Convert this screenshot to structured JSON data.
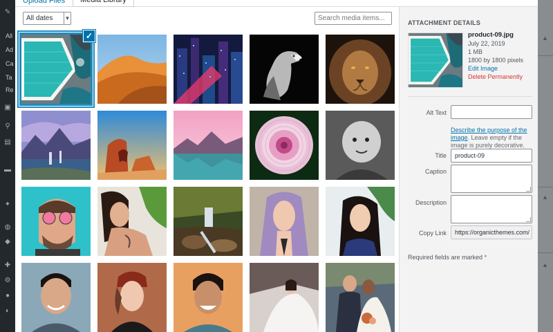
{
  "tabs": [
    {
      "label": "Upload Files",
      "active": false
    },
    {
      "label": "Media Library",
      "active": true
    }
  ],
  "filter": {
    "selected": "All dates"
  },
  "search": {
    "placeholder": "Search media items..."
  },
  "attachment": {
    "heading": "ATTACHMENT DETAILS",
    "filename": "product-09.jpg",
    "date": "July 22, 2019",
    "size": "1 MB",
    "dimensions": "1800 by 1800 pixels",
    "edit_link": "Edit Image",
    "delete_link": "Delete Permanently"
  },
  "fields": {
    "alt_label": "Alt Text",
    "alt_value": "",
    "alt_desc_link": "Describe the purpose of the image",
    "alt_desc_rest": ". Leave empty if the image is purely decorative.",
    "title_label": "Title",
    "title_value": "product-09",
    "caption_label": "Caption",
    "description_label": "Description",
    "copy_label": "Copy Link",
    "copy_value": "https://organicthemes.com/"
  },
  "required_note": {
    "text": "Required fields are marked",
    "star": "*"
  },
  "media_items": [
    {
      "name": "pool-aerial",
      "selected": true
    },
    {
      "name": "desert-dunes"
    },
    {
      "name": "city-night"
    },
    {
      "name": "eagle-bw"
    },
    {
      "name": "lion"
    },
    {
      "name": "mountain-waterfall"
    },
    {
      "name": "canyon-rocks"
    },
    {
      "name": "pink-lake"
    },
    {
      "name": "dahlia-flower"
    },
    {
      "name": "baby-bw"
    },
    {
      "name": "man-sunglasses"
    },
    {
      "name": "woman-tattoo"
    },
    {
      "name": "forest-waterfall"
    },
    {
      "name": "woman-lavender-hair"
    },
    {
      "name": "woman-outdoor"
    },
    {
      "name": "man-portrait"
    },
    {
      "name": "woman-beanie"
    },
    {
      "name": "man-smiling"
    },
    {
      "name": "bride-car"
    },
    {
      "name": "wedding-couple"
    }
  ],
  "colors": {
    "accent": "#0073aa",
    "selection": "#1e8cbe",
    "danger": "#d63638"
  }
}
